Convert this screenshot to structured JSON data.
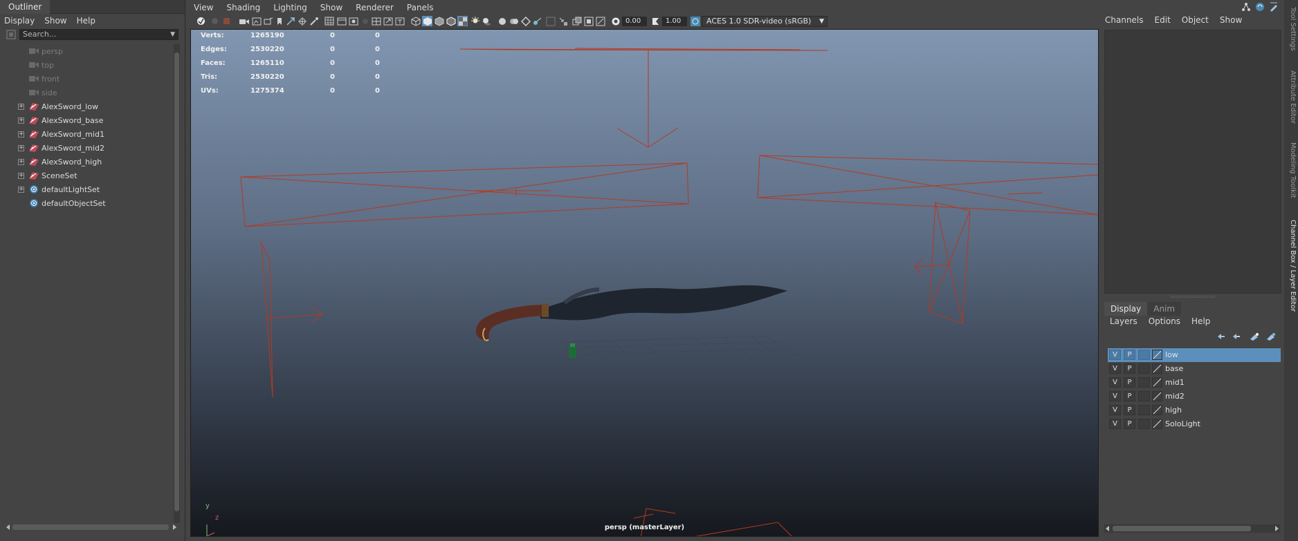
{
  "outliner": {
    "title": "Outliner",
    "menu": [
      "Display",
      "Show",
      "Help"
    ],
    "search_placeholder": "Search...",
    "items": [
      {
        "label": "persp",
        "icon": "camera-icon",
        "expandable": false,
        "hidden": true
      },
      {
        "label": "top",
        "icon": "camera-icon",
        "expandable": false,
        "hidden": true
      },
      {
        "label": "front",
        "icon": "camera-icon",
        "expandable": false,
        "hidden": true
      },
      {
        "label": "side",
        "icon": "camera-icon",
        "expandable": false,
        "hidden": true
      },
      {
        "label": "AlexSword_low",
        "icon": "mesh-transform-icon",
        "expandable": true,
        "hidden": false
      },
      {
        "label": "AlexSword_base",
        "icon": "mesh-transform-icon",
        "expandable": true,
        "hidden": false
      },
      {
        "label": "AlexSword_mid1",
        "icon": "mesh-transform-icon",
        "expandable": true,
        "hidden": false
      },
      {
        "label": "AlexSword_mid2",
        "icon": "mesh-transform-icon",
        "expandable": true,
        "hidden": false
      },
      {
        "label": "AlexSword_high",
        "icon": "mesh-transform-icon",
        "expandable": true,
        "hidden": false
      },
      {
        "label": "SceneSet",
        "icon": "mesh-transform-icon",
        "expandable": true,
        "hidden": false
      },
      {
        "label": "defaultLightSet",
        "icon": "set-icon",
        "expandable": true,
        "hidden": false
      },
      {
        "label": "defaultObjectSet",
        "icon": "set-icon",
        "expandable": false,
        "hidden": false
      }
    ]
  },
  "viewport": {
    "menu": [
      "View",
      "Shading",
      "Lighting",
      "Show",
      "Renderer",
      "Panels"
    ],
    "exposure": "0.00",
    "gamma": "1.00",
    "color_space": "ACES 1.0 SDR-video (sRGB)",
    "camera_label": "persp (masterLayer)",
    "hud": [
      {
        "name": "Verts:",
        "v1": "1265190",
        "v2": "0",
        "v3": "0"
      },
      {
        "name": "Edges:",
        "v1": "2530220",
        "v2": "0",
        "v3": "0"
      },
      {
        "name": "Faces:",
        "v1": "1265110",
        "v2": "0",
        "v3": "0"
      },
      {
        "name": "Tris:",
        "v1": "2530220",
        "v2": "0",
        "v3": "0"
      },
      {
        "name": "UVs:",
        "v1": "1275374",
        "v2": "0",
        "v3": "0"
      }
    ],
    "axis_y": "y",
    "axis_z": "z"
  },
  "channel_box": {
    "menu": [
      "Channels",
      "Edit",
      "Object",
      "Show"
    ]
  },
  "layer_editor": {
    "tabs": [
      "Display",
      "Anim"
    ],
    "active_tab": "Display",
    "menu": [
      "Layers",
      "Options",
      "Help"
    ],
    "layers": [
      {
        "v": "V",
        "p": "P",
        "name": "low",
        "selected": true
      },
      {
        "v": "V",
        "p": "P",
        "name": "base",
        "selected": false
      },
      {
        "v": "V",
        "p": "P",
        "name": "mid1",
        "selected": false
      },
      {
        "v": "V",
        "p": "P",
        "name": "mid2",
        "selected": false
      },
      {
        "v": "V",
        "p": "P",
        "name": "high",
        "selected": false
      },
      {
        "v": "V",
        "p": "P",
        "name": "SoloLight",
        "selected": false
      }
    ]
  },
  "side_tabs": [
    "Tool Settings",
    "Attribute Editor",
    "Modeling Toolkit",
    "Channel Box / Layer Editor"
  ],
  "colors": {
    "selection": "#5c8fbb",
    "wireframe": "#b33a22",
    "viewport_top": "#8196b1",
    "viewport_bottom": "#15181d"
  }
}
